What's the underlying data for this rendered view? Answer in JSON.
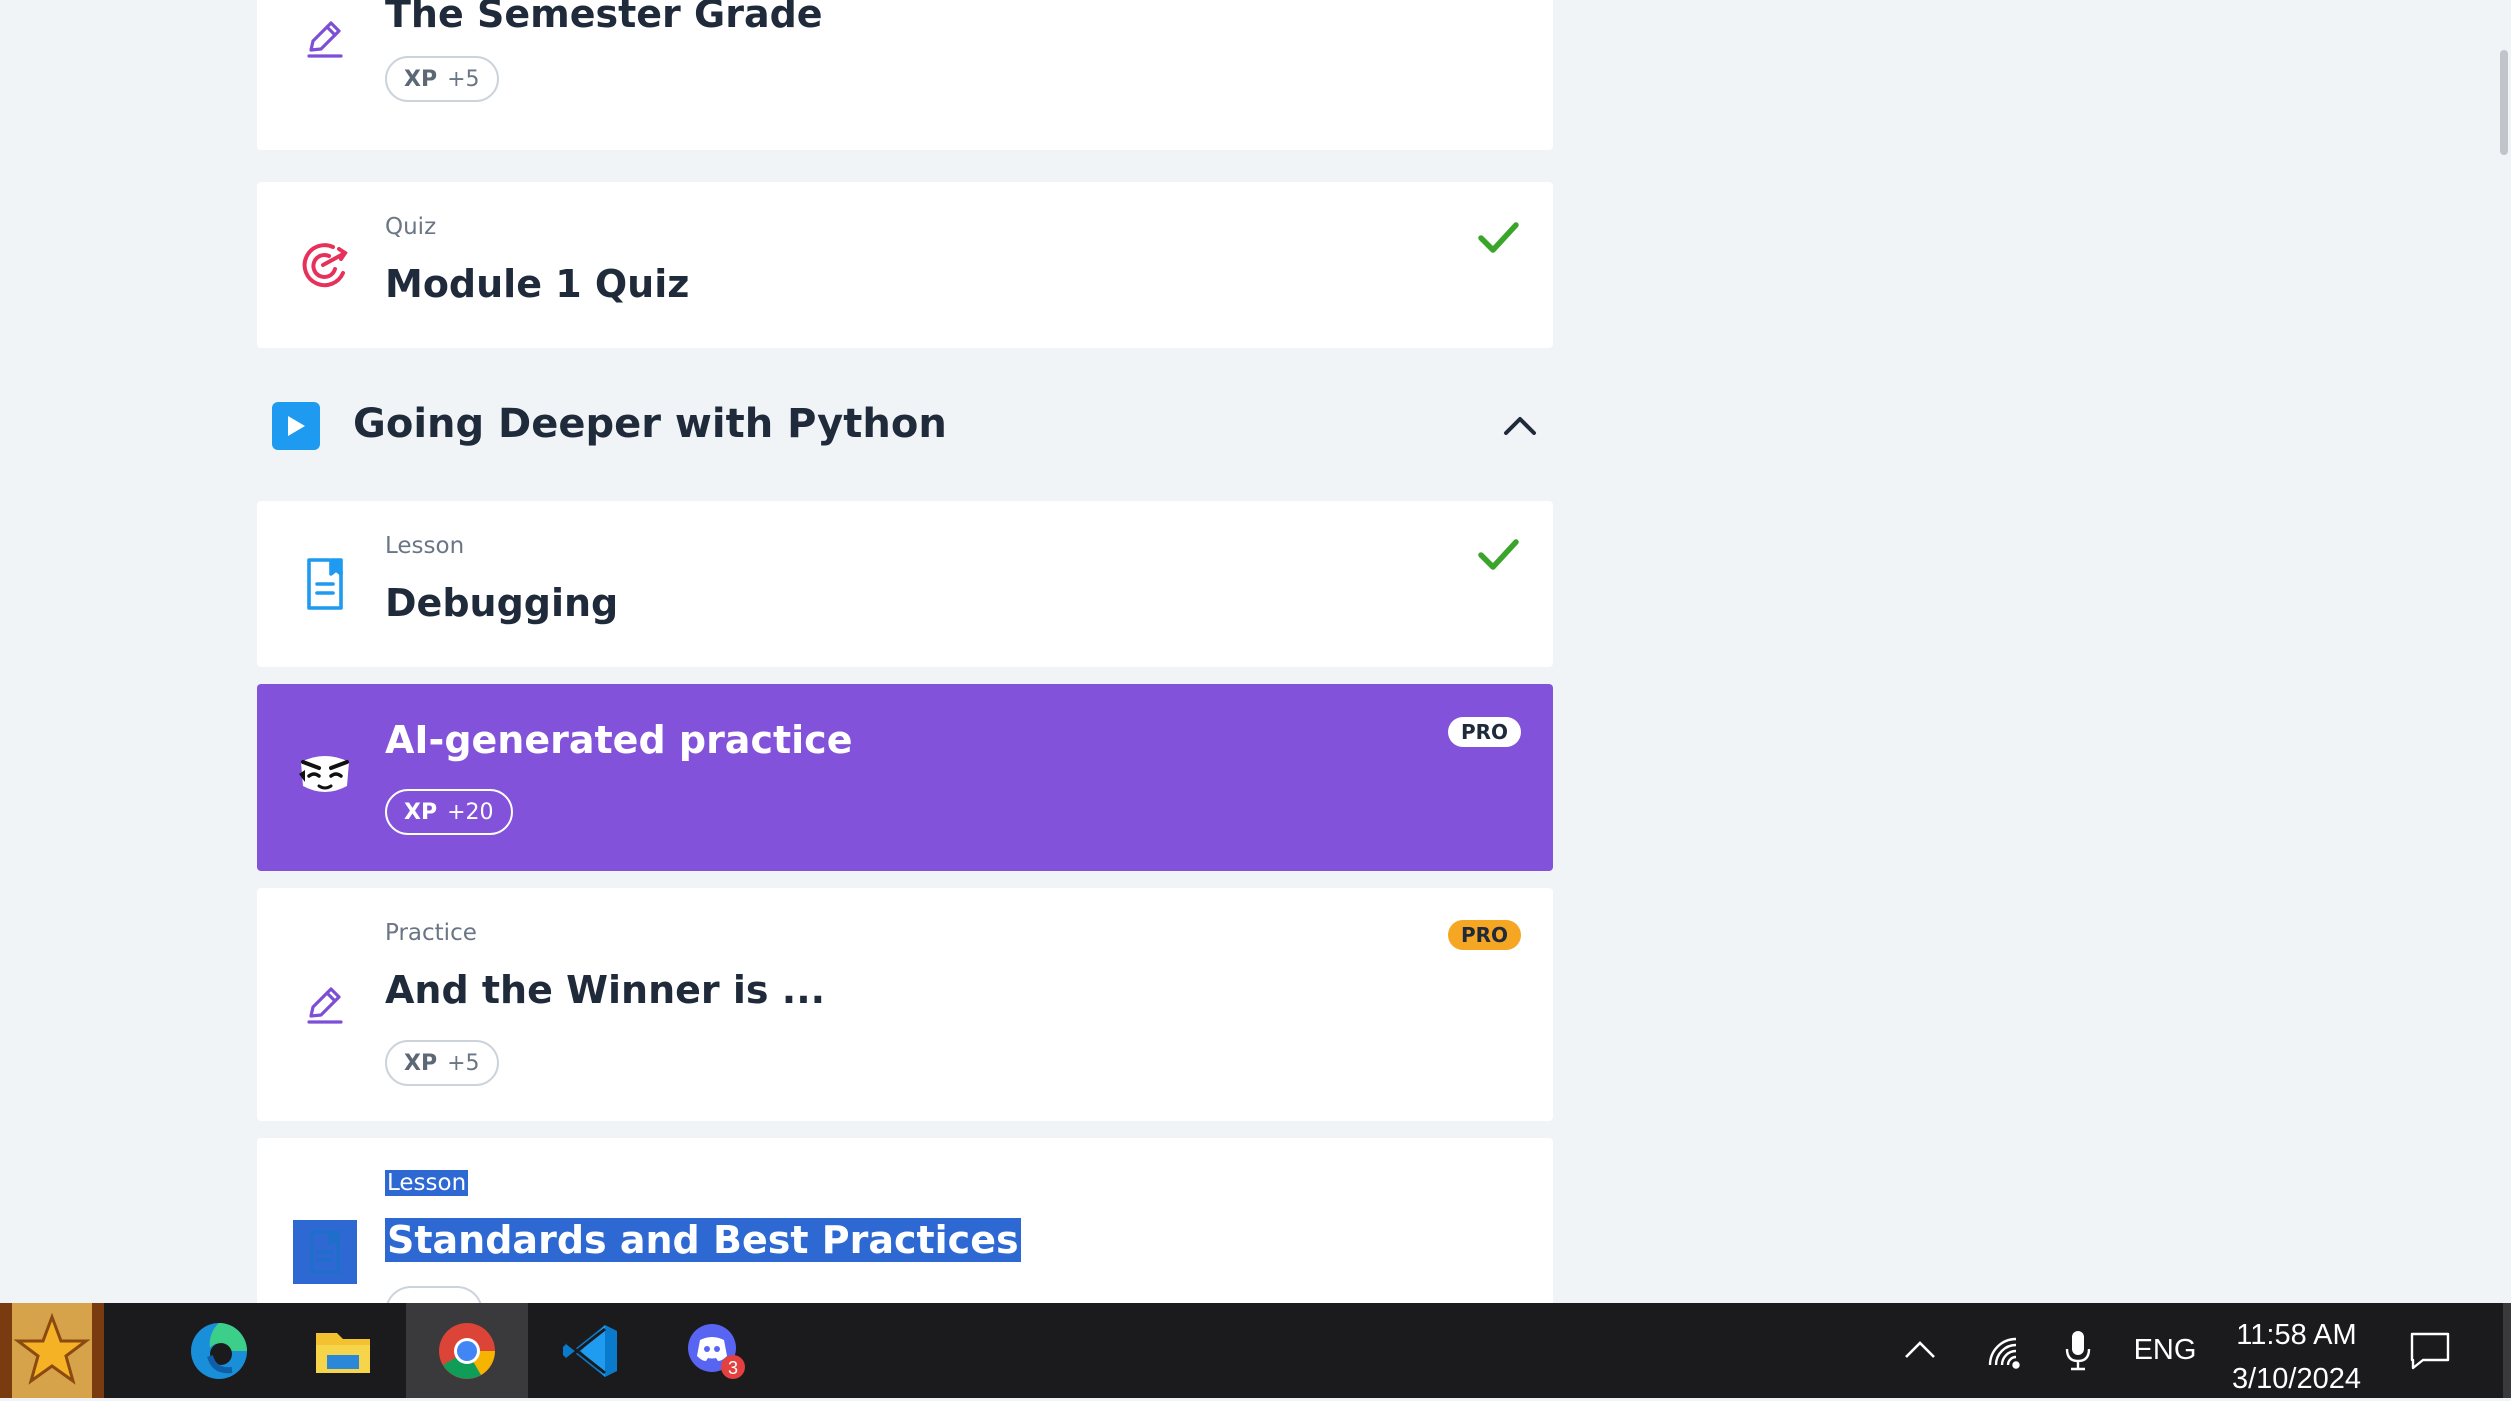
{
  "items": [
    {
      "type": "",
      "title": "The Semester Grade",
      "xp_label": "XP",
      "xp_value": "+5"
    },
    {
      "type": "Quiz",
      "title": "Module 1 Quiz",
      "completed": true
    },
    {
      "type": "Lesson",
      "title": "Debugging",
      "completed": true
    },
    {
      "title": "AI-generated practice",
      "xp_label": "XP",
      "xp_value": "+20",
      "badge": "PRO"
    },
    {
      "type": "Practice",
      "title": "And the Winner is ...",
      "xp_label": "XP",
      "xp_value": "+5",
      "badge": "PRO"
    },
    {
      "type": "Lesson",
      "title": "Standards and Best Practices"
    }
  ],
  "section": {
    "title": "Going Deeper with Python",
    "expanded": true
  },
  "colors": {
    "accent_purple": "#8352da",
    "check_green": "#3aa52a",
    "pro_yellow": "#f5a623",
    "quiz_red": "#e8315a",
    "lesson_blue": "#1e9bf0",
    "selection_blue": "#2d68d3"
  },
  "taskbar": {
    "apps": [
      "media-player-icon",
      "edge-icon",
      "file-explorer-icon",
      "chrome-icon",
      "vscode-icon",
      "discord-icon"
    ],
    "active_app": "chrome-icon",
    "discord_badge": "3",
    "language": "ENG",
    "time": "11:58 AM",
    "date": "3/10/2024"
  }
}
